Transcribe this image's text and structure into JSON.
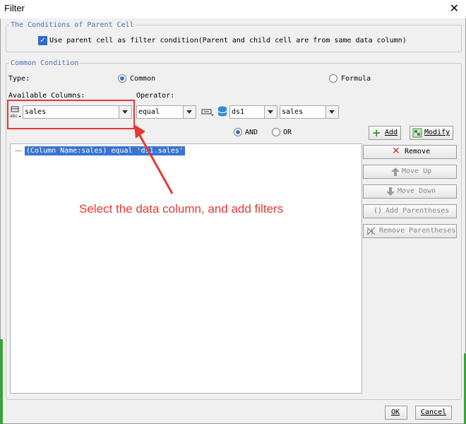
{
  "window": {
    "title": "Filter"
  },
  "parent_group": {
    "legend": "The Conditions of Parent Cell",
    "checkbox_label": "Use parent cell as filter condition(Parent and child cell are from same data column)"
  },
  "common_group": {
    "legend": "Common Condition",
    "type_label": "Type:",
    "type_common": "Common",
    "type_formula": "Formula",
    "available_columns_label": "Available Columns:",
    "operator_label": "Operator:",
    "column_value": "sales",
    "operator_value": "equal",
    "dataset_value": "ds1",
    "field_value": "sales",
    "and_label": "AND",
    "or_label": "OR"
  },
  "buttons": {
    "add": "Add",
    "modify": "Modify",
    "remove": "Remove",
    "move_up": "Move Up",
    "move_down": "Move Down",
    "add_parentheses": "Add Parentheses",
    "remove_parentheses": "Remove Parentheses",
    "ok": "OK",
    "cancel": "Cancel"
  },
  "conditions": [
    "(Column Name:sales) equal 'ds1.sales'"
  ],
  "annotation": "Select the data column, and add filters",
  "colors": {
    "accent": "#3874d0",
    "annotation": "#e53935",
    "legend": "#4a6fb3"
  }
}
